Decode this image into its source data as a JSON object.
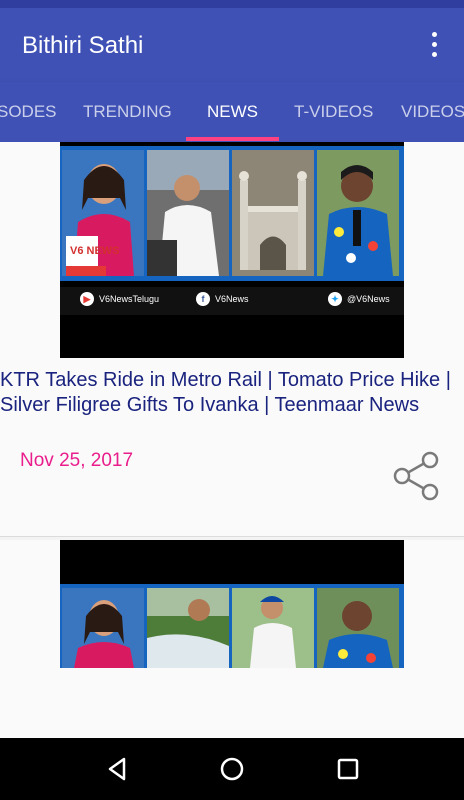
{
  "app": {
    "title": "Bithiri Sathi"
  },
  "tabs": [
    {
      "label": "SODES"
    },
    {
      "label": "TRENDING"
    },
    {
      "label": "NEWS"
    },
    {
      "label": "T-VIDEOS"
    },
    {
      "label": "VIDEOS"
    }
  ],
  "active_tab": "NEWS",
  "thumbnail_social": {
    "youtube": "V6NewsTelugu",
    "facebook": "V6News",
    "twitter": "@V6News"
  },
  "thumbnail_badge": "V6 NEWS",
  "cards": [
    {
      "title": "KTR Takes Ride in Metro Rail | Tomato Price Hike | Silver Filigree Gifts To Ivanka | Teenmaar News",
      "date": "Nov 25, 2017"
    }
  ],
  "colors": {
    "primary": "#3f51b5",
    "primary_dark": "#303f9f",
    "accent": "#ff4081",
    "title_text": "#1a237e",
    "date_text": "#e91e8c"
  },
  "icons": [
    "overflow-menu-icon",
    "share-icon",
    "nav-back-icon",
    "nav-home-icon",
    "nav-recents-icon"
  ]
}
